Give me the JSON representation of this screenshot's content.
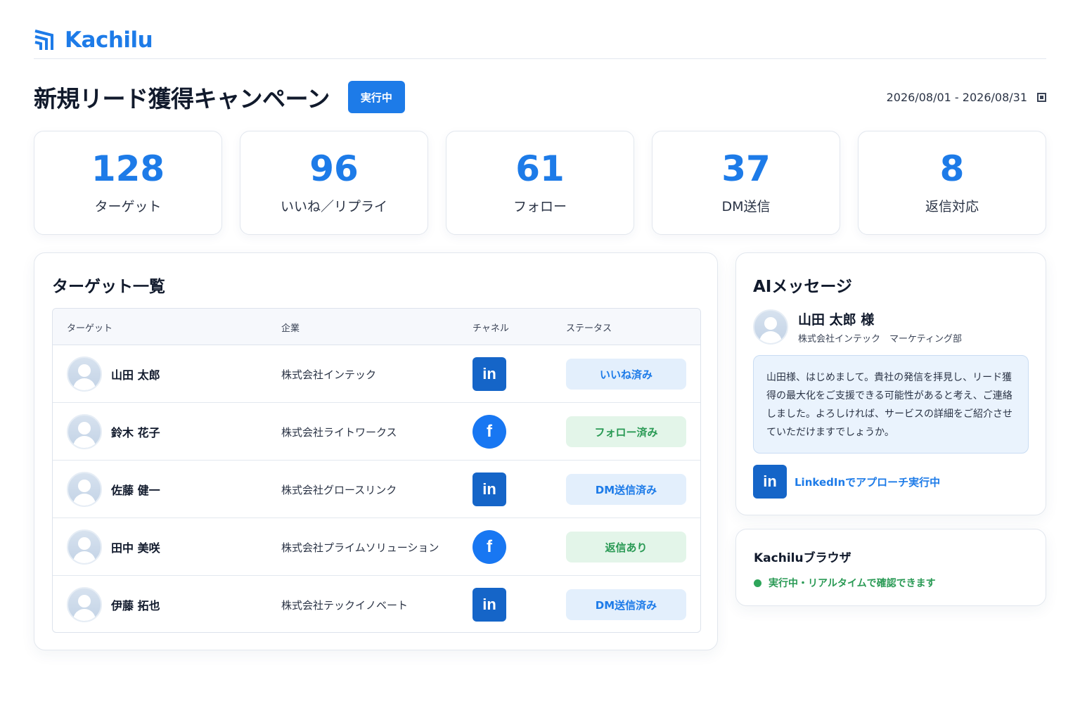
{
  "brand": {
    "name": "Kachilu",
    "color": "#1d7be8"
  },
  "campaign": {
    "title": "新規リード獲得キャンペーン",
    "status": "実行中",
    "date_range": "2026/08/01 - 2026/08/31"
  },
  "stats": [
    {
      "value": "128",
      "label": "ターゲット"
    },
    {
      "value": "96",
      "label": "いいね／リプライ"
    },
    {
      "value": "61",
      "label": "フォロー"
    },
    {
      "value": "37",
      "label": "DM送信"
    },
    {
      "value": "8",
      "label": "返信対応"
    }
  ],
  "targets": {
    "title": "ターゲット一覧",
    "columns": {
      "target": "ターゲット",
      "company": "企業",
      "channel": "チャネル",
      "status": "ステータス"
    },
    "rows": [
      {
        "name": "山田 太郎",
        "company": "株式会社インテック",
        "channel": "linkedin",
        "channel_glyph": "in",
        "status": "いいね済み",
        "status_color": "blue"
      },
      {
        "name": "鈴木 花子",
        "company": "株式会社ライトワークス",
        "channel": "facebook",
        "channel_glyph": "f",
        "status": "フォロー済み",
        "status_color": "green"
      },
      {
        "name": "佐藤 健一",
        "company": "株式会社グロースリンク",
        "channel": "linkedin",
        "channel_glyph": "in",
        "status": "DM送信済み",
        "status_color": "blue"
      },
      {
        "name": "田中 美咲",
        "company": "株式会社プライムソリューション",
        "channel": "facebook",
        "channel_glyph": "f",
        "status": "返信あり",
        "status_color": "green"
      },
      {
        "name": "伊藤 拓也",
        "company": "株式会社テックイノベート",
        "channel": "linkedin",
        "channel_glyph": "in",
        "status": "DM送信済み",
        "status_color": "blue"
      }
    ]
  },
  "ai_message": {
    "title": "AIメッセージ",
    "recipient_name": "山田 太郎 様",
    "recipient_org": "株式会社インテック　マーケティング部",
    "body": "山田様、はじめまして。貴社の発信を拝見し、リード獲得の最大化をご支援できる可能性があると考え、ご連絡しました。よろしければ、サービスの詳細をご紹介させていただけますでしょうか。",
    "action_glyph": "in",
    "action_label": "LinkedInでアプローチ実行中"
  },
  "browser": {
    "title": "Kachiluブラウザ",
    "status": "実行中・リアルタイムで確認できます",
    "status_color": "#2ea55a"
  },
  "colors": {
    "accent": "#1d7be8",
    "linkedin": "#1565c8",
    "facebook": "#1877f2",
    "success": "#2a9a55"
  }
}
